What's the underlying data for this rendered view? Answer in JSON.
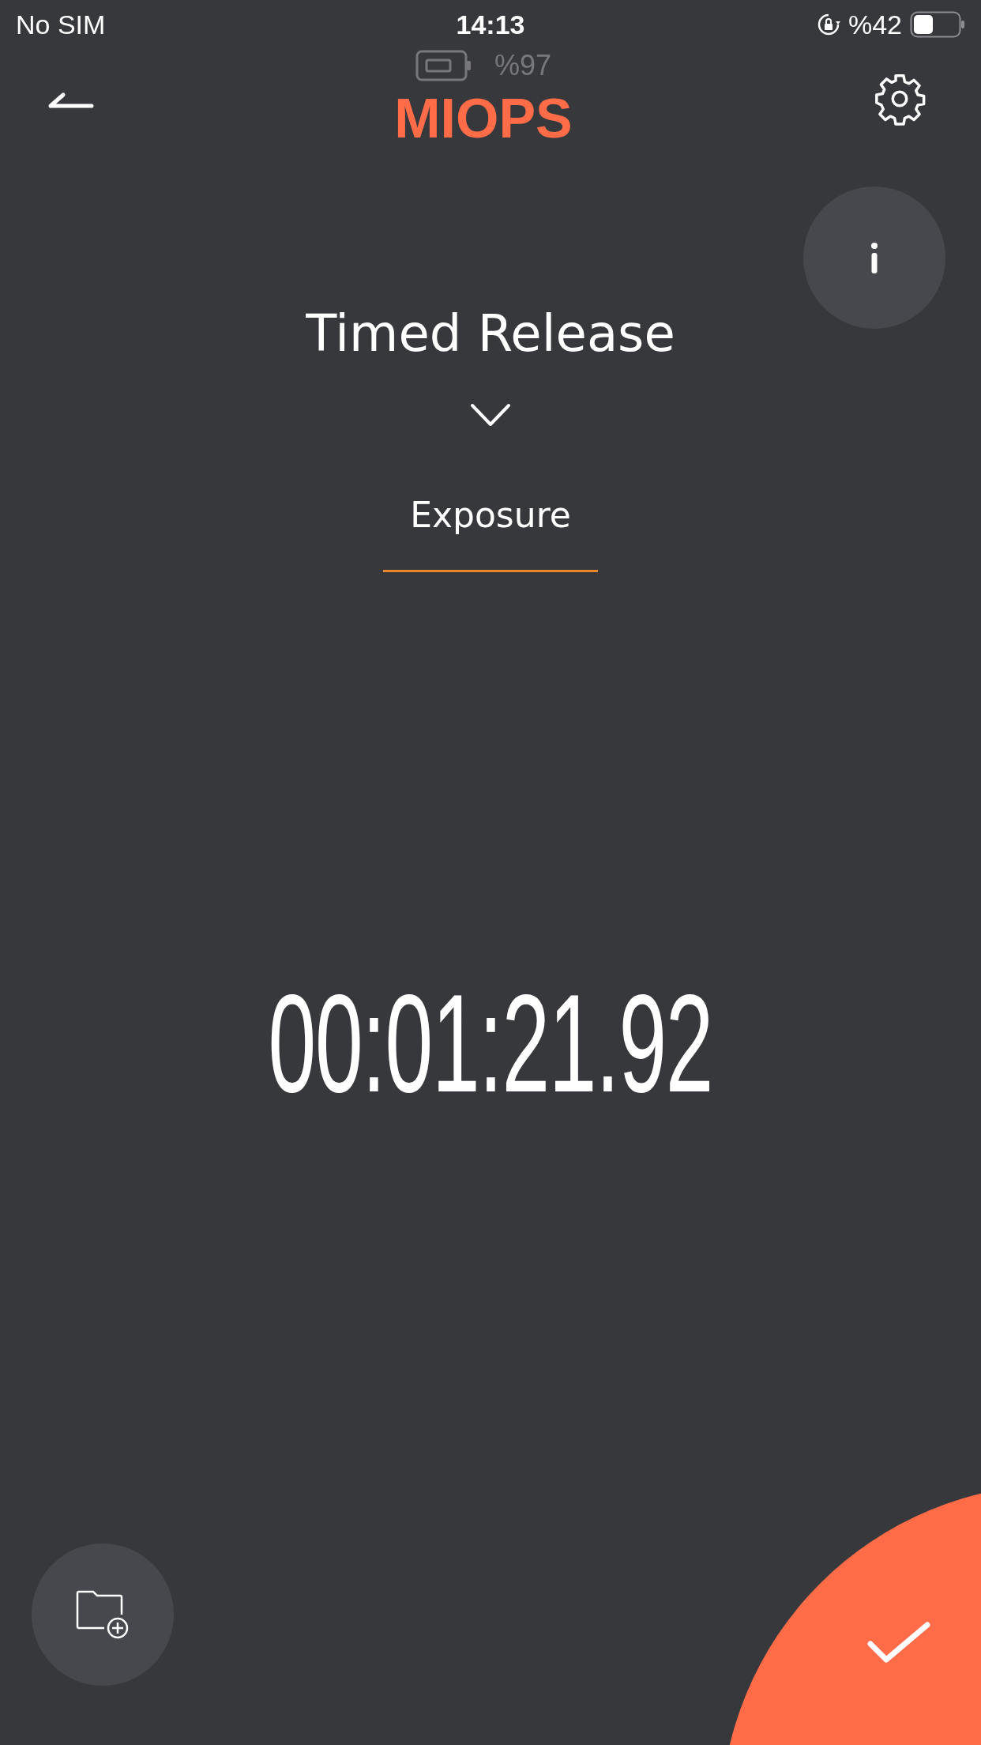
{
  "status_bar": {
    "carrier": "No SIM",
    "time": "14:13",
    "battery": "%42"
  },
  "header": {
    "device_battery": "%97",
    "logo": "MIOPS"
  },
  "mode": {
    "title": "Timed Release"
  },
  "tabs": [
    {
      "label": "Exposure",
      "selected": true
    }
  ],
  "timer": {
    "value": "00:01:21.92"
  }
}
